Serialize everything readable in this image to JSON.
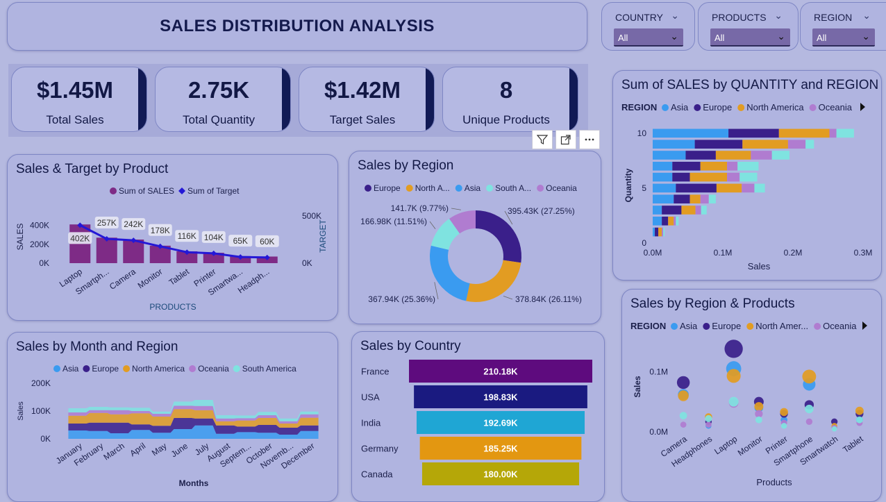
{
  "header": {
    "title": "SALES DISTRIBUTION ANALYSIS"
  },
  "slicers": [
    {
      "label": "COUNTRY",
      "value": "All"
    },
    {
      "label": "PRODUCTS",
      "value": "All"
    },
    {
      "label": "REGION",
      "value": "All"
    }
  ],
  "kpis": [
    {
      "value": "$1.45M",
      "label": "Total Sales"
    },
    {
      "value": "2.75K",
      "label": "Total Quantity"
    },
    {
      "value": "$1.42M",
      "label": "Target Sales"
    },
    {
      "value": "8",
      "label": "Unique Products"
    }
  ],
  "visual_header_icons": [
    "filter-icon",
    "focus-mode-icon",
    "more-options-icon"
  ],
  "colors": {
    "asia": "#3a9bf0",
    "europe": "#3a1f8a",
    "north_america": "#e29c22",
    "oceania": "#b07cd0",
    "south_america": "#7fe3e0",
    "sales_bar": "#7e2b86",
    "target_line": "#2418d6"
  },
  "chart_data": [
    {
      "id": "sales-target",
      "type": "bar",
      "title": "Sales & Target by Product",
      "xlabel": "PRODUCTS",
      "ylabel": "SALES",
      "y2label": "TARGET",
      "legend": [
        "Sum of SALES",
        "Sum of Target"
      ],
      "categories": [
        "Laptop",
        "Smartph...",
        "Camera",
        "Monitor",
        "Tablet",
        "Printer",
        "Smartwa...",
        "Headph..."
      ],
      "yticks": [
        "400K",
        "200K",
        "0K"
      ],
      "y2ticks": [
        "500K",
        "0K"
      ],
      "ylim": [
        0,
        500000
      ],
      "y2lim": [
        0,
        500000
      ],
      "series": [
        {
          "name": "Sum of SALES",
          "values": [
            410000,
            270000,
            250000,
            185000,
            125000,
            110000,
            75000,
            70000
          ]
        },
        {
          "name": "Sum of Target",
          "values": [
            402000,
            257000,
            242000,
            178000,
            116000,
            104000,
            65000,
            60000
          ],
          "labels": [
            "402K",
            "257K",
            "242K",
            "178K",
            "116K",
            "104K",
            "65K",
            "60K"
          ]
        }
      ]
    },
    {
      "id": "sales-region",
      "type": "pie",
      "title": "Sales by Region",
      "legend": [
        "Europe",
        "North A...",
        "Asia",
        "South A...",
        "Oceania"
      ],
      "slices": [
        {
          "name": "Europe",
          "value": 395430,
          "label": "395.43K (27.25%)"
        },
        {
          "name": "North America",
          "value": 378840,
          "label": "378.84K (26.11%)"
        },
        {
          "name": "Asia",
          "value": 367940,
          "label": "367.94K (25.36%)"
        },
        {
          "name": "South America",
          "value": 166980,
          "label": "166.98K (11.51%)"
        },
        {
          "name": "Oceania",
          "value": 141700,
          "label": "141.7K (9.77%)"
        }
      ]
    },
    {
      "id": "qty-region",
      "type": "bar",
      "title": "Sum of SALES by QUANTITY and REGION",
      "legend_title": "REGION",
      "legend": [
        "Asia",
        "Europe",
        "North America",
        "Oceania"
      ],
      "xlabel": "Sales",
      "ylabel": "Quantity",
      "xticks": [
        "0.0M",
        "0.1M",
        "0.2M",
        "0.3M"
      ],
      "yticks": [
        "10",
        "5",
        "0"
      ],
      "xlim": [
        0,
        0.3
      ],
      "ylim": [
        0,
        10
      ],
      "categories": [
        10,
        9,
        8,
        7,
        6,
        5,
        4,
        3,
        2,
        1
      ],
      "series": [
        {
          "name": "Asia",
          "values": [
            0.108,
            0.06,
            0.047,
            0.028,
            0.028,
            0.033,
            0.03,
            0.013,
            0.013,
            0.003
          ]
        },
        {
          "name": "Europe",
          "values": [
            0.072,
            0.068,
            0.043,
            0.04,
            0.025,
            0.058,
            0.023,
            0.028,
            0.009,
            0.005
          ]
        },
        {
          "name": "North America",
          "values": [
            0.072,
            0.065,
            0.05,
            0.038,
            0.053,
            0.036,
            0.015,
            0.02,
            0.008,
            0.005
          ]
        },
        {
          "name": "Oceania",
          "values": [
            0.01,
            0.025,
            0.03,
            0.015,
            0.018,
            0.018,
            0.012,
            0.008,
            0.003,
            0.002
          ]
        },
        {
          "name": "South America",
          "values": [
            0.025,
            0.012,
            0.025,
            0.03,
            0.025,
            0.015,
            0.01,
            0.008,
            0.004,
            0.002
          ]
        }
      ]
    },
    {
      "id": "month-region",
      "type": "area",
      "title": "Sales by Month and Region",
      "legend": [
        "Asia",
        "Europe",
        "North America",
        "Oceania",
        "South America"
      ],
      "xlabel": "Months",
      "ylabel": "Sales",
      "yticks": [
        "200K",
        "100K",
        "0K"
      ],
      "ylim": [
        0,
        200000
      ],
      "categories": [
        "January",
        "February",
        "March",
        "April",
        "May",
        "June",
        "July",
        "August",
        "Septem...",
        "October",
        "Novemb...",
        "December"
      ],
      "series": [
        {
          "name": "Asia",
          "values": [
            30000,
            28000,
            20000,
            32000,
            22000,
            35000,
            48000,
            18000,
            24000,
            22000,
            15000,
            28000
          ]
        },
        {
          "name": "Europe",
          "values": [
            25000,
            30000,
            38000,
            20000,
            25000,
            40000,
            25000,
            30000,
            20000,
            28000,
            25000,
            20000
          ]
        },
        {
          "name": "North America",
          "values": [
            28000,
            35000,
            30000,
            40000,
            33000,
            32000,
            30000,
            15000,
            22000,
            25000,
            15000,
            28000
          ]
        },
        {
          "name": "Oceania",
          "values": [
            12000,
            10000,
            15000,
            8000,
            10000,
            12000,
            15000,
            10000,
            8000,
            10000,
            8000,
            12000
          ]
        },
        {
          "name": "South America",
          "values": [
            15000,
            12000,
            10000,
            12000,
            8000,
            15000,
            22000,
            12000,
            10000,
            12000,
            10000,
            10000
          ]
        }
      ]
    },
    {
      "id": "sales-country",
      "type": "bar",
      "title": "Sales by Country",
      "categories": [
        "France",
        "USA",
        "India",
        "Germany",
        "Canada"
      ],
      "values": [
        210180,
        198830,
        192690,
        185250,
        180000
      ],
      "labels": [
        "210.18K",
        "198.83K",
        "192.69K",
        "185.25K",
        "180.00K"
      ],
      "colors": [
        "#5e0b7e",
        "#1a1a80",
        "#1fa6d4",
        "#e39711",
        "#b5a708"
      ]
    },
    {
      "id": "region-products",
      "type": "scatter",
      "title": "Sales by Region & Products",
      "legend_title": "REGION",
      "legend": [
        "Asia",
        "Europe",
        "North Amer...",
        "Oceania"
      ],
      "xlabel": "Products",
      "ylabel": "Sales",
      "yticks": [
        "0.1M",
        "0.0M"
      ],
      "ylim": [
        0,
        0.15
      ],
      "categories": [
        "Camera",
        "Headphones",
        "Laptop",
        "Monitor",
        "Printer",
        "Smartphone",
        "Smartwatch",
        "Tablet"
      ],
      "series": [
        {
          "name": "Asia",
          "values": [
            0.062,
            0.01,
            0.105,
            0.04,
            0.02,
            0.079,
            0.008,
            0.02
          ]
        },
        {
          "name": "Europe",
          "values": [
            0.082,
            0.017,
            0.138,
            0.05,
            0.03,
            0.045,
            0.017,
            0.03
          ]
        },
        {
          "name": "North America",
          "values": [
            0.06,
            0.025,
            0.093,
            0.042,
            0.033,
            0.092,
            0.01,
            0.035
          ]
        },
        {
          "name": "Oceania",
          "values": [
            0.012,
            0.012,
            0.048,
            0.03,
            0.015,
            0.017,
            0.007,
            0.015
          ]
        },
        {
          "name": "South America",
          "values": [
            0.027,
            0.022,
            0.05,
            0.02,
            0.01,
            0.038,
            0.005,
            0.02
          ]
        }
      ]
    }
  ]
}
